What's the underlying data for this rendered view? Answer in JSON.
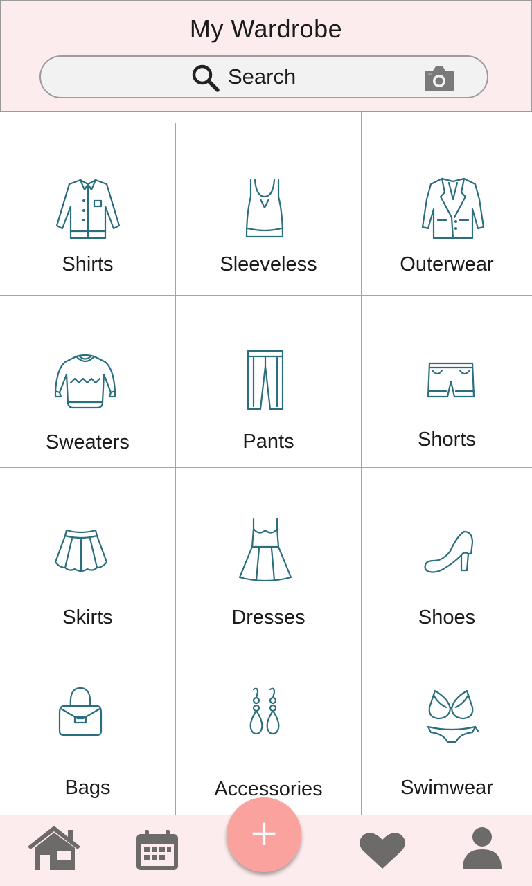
{
  "header": {
    "title": "My Wardrobe",
    "search_placeholder": "Search"
  },
  "categories": [
    {
      "label": "Shirts",
      "icon": "shirt-icon"
    },
    {
      "label": "Sleeveless",
      "icon": "tank-top-icon"
    },
    {
      "label": "Outerwear",
      "icon": "blazer-icon"
    },
    {
      "label": "Sweaters",
      "icon": "sweater-icon"
    },
    {
      "label": "Pants",
      "icon": "pants-icon"
    },
    {
      "label": "Shorts",
      "icon": "shorts-icon"
    },
    {
      "label": "Skirts",
      "icon": "skirt-icon"
    },
    {
      "label": "Dresses",
      "icon": "dress-icon"
    },
    {
      "label": "Shoes",
      "icon": "high-heel-icon"
    },
    {
      "label": "Bags",
      "icon": "handbag-icon"
    },
    {
      "label": "Accessories",
      "icon": "earrings-icon"
    },
    {
      "label": "Swimwear",
      "icon": "bikini-icon"
    }
  ],
  "bottom_nav": {
    "items": [
      "home-icon",
      "calendar-icon",
      "add-icon",
      "heart-icon",
      "profile-icon"
    ],
    "add_symbol": "+"
  },
  "colors": {
    "header_bg": "#fdeced",
    "icon_teal": "#2b6e7e",
    "fab": "#f9a29e",
    "nav_icon": "#6d6a6a"
  }
}
